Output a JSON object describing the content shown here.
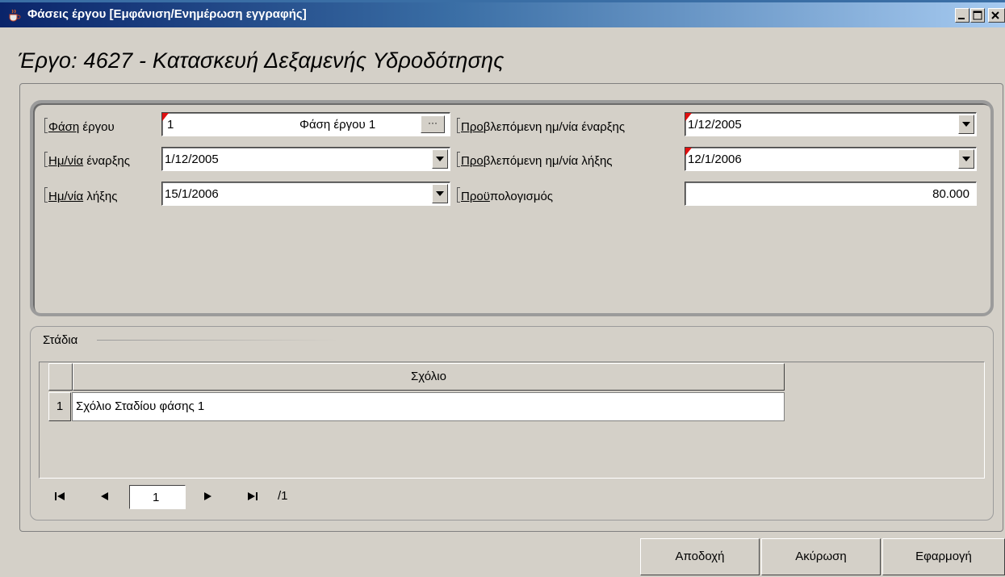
{
  "window": {
    "title": "Φάσεις έργου [Εμφάνιση/Ενημέρωση  εγγραφής]"
  },
  "project": {
    "title": "Έργο: 4627 - Κατασκευή Δεξαμενής Υδροδότησης"
  },
  "form": {
    "phase": {
      "label_u": "Φάση",
      "label_rest": " έργου",
      "value": "1",
      "description": "Φάση έργου 1",
      "lookup_label": "···"
    },
    "start_date": {
      "label_u": "Ημ/νία",
      "label_rest": " έναρξης",
      "value": "1/12/2005"
    },
    "end_date": {
      "label_u": "Ημ/νία",
      "label_rest": " λήξης",
      "value": "15/1/2006"
    },
    "planned_start": {
      "label_u": "Προ",
      "label_rest": "βλεπόμενη ημ/νία έναρξης",
      "value": "1/12/2005"
    },
    "planned_end": {
      "label_u": "Προ",
      "label_rest": "βλεπόμενη ημ/νία λήξης",
      "value": "12/1/2006"
    },
    "budget": {
      "label_u": "Προϋ",
      "label_rest": "πολογισμός",
      "value": "80.000"
    }
  },
  "stages": {
    "section_label": "Στάδια",
    "column_header": "Σχόλιο",
    "rows": [
      {
        "num": "1",
        "comment": "Σχόλιο Σταδίου φάσης 1"
      }
    ]
  },
  "pager": {
    "current_page": "1",
    "total": "/1"
  },
  "buttons": {
    "accept": "Αποδοχή",
    "cancel": "Ακύρωση",
    "apply": "Εφαρμογή"
  },
  "icons": {
    "app": "java-cup-icon",
    "minimize": "minimize-icon",
    "maximize": "maximize-icon",
    "close": "close-icon",
    "dropdown": "chevron-down-icon",
    "first": "first-page-icon",
    "prev": "prev-page-icon",
    "next": "next-page-icon",
    "last": "last-page-icon"
  },
  "colors": {
    "titlebar_start": "#0a246a",
    "titlebar_end": "#a6caf0",
    "window_bg": "#d4d0c8",
    "required_marker": "#e01010"
  }
}
